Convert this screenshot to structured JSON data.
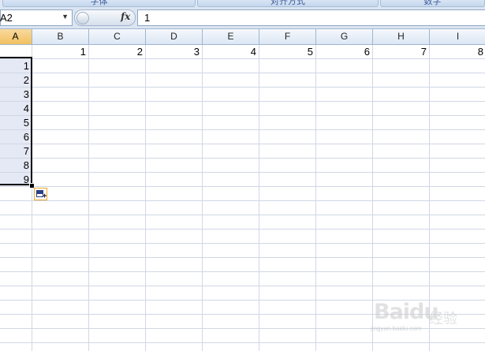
{
  "ribbon": {
    "groups": [
      {
        "label": "字体"
      },
      {
        "label": "对齐方式"
      },
      {
        "label": "数字"
      }
    ]
  },
  "formula_bar": {
    "name_box": "A2",
    "fx_label": "fx",
    "formula": "1"
  },
  "columns": [
    "A",
    "B",
    "C",
    "D",
    "E",
    "F",
    "G",
    "H",
    "I"
  ],
  "selected_column": "A",
  "row1_values": [
    "",
    "1",
    "2",
    "3",
    "4",
    "5",
    "6",
    "7",
    "8"
  ],
  "columnA_values": [
    "1",
    "2",
    "3",
    "4",
    "5",
    "6",
    "7",
    "8",
    "9"
  ],
  "watermark": {
    "brand": "Baidu",
    "cn": "经验",
    "url": "jingyan.baidu.com"
  }
}
